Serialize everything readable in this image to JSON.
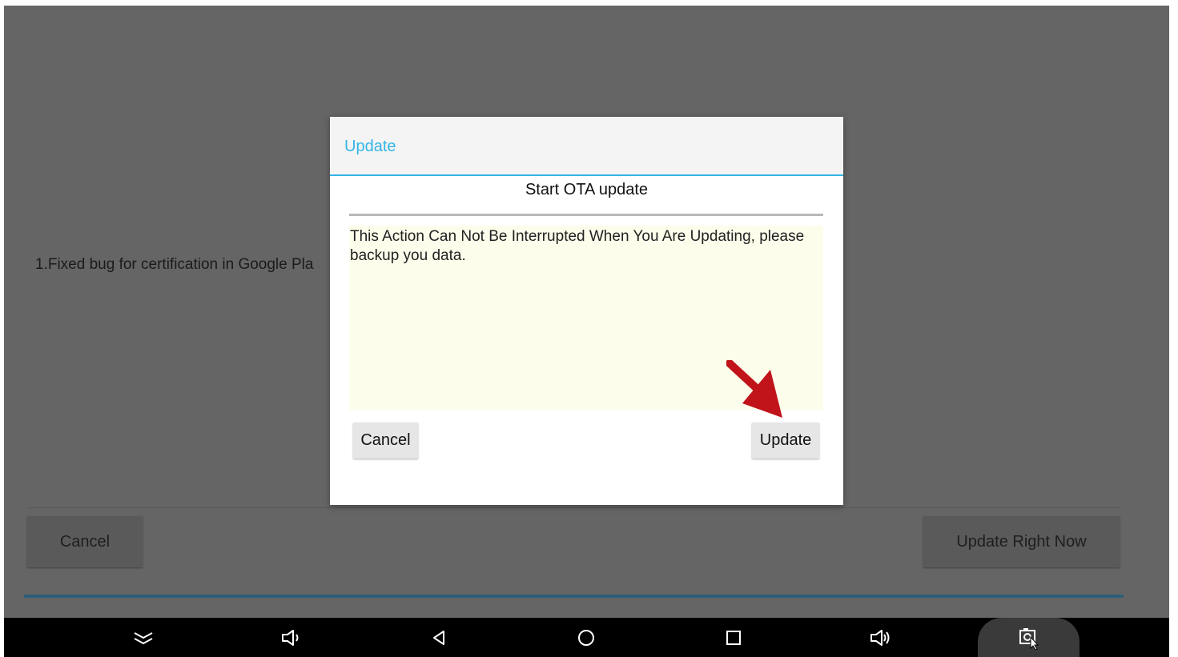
{
  "background": {
    "release_note": "1.Fixed bug for certification in Google Pla",
    "cancel_label": "Cancel",
    "update_now_label": "Update Right Now"
  },
  "dialog": {
    "title": "Update",
    "subtitle": "Start OTA update",
    "message": "This Action Can Not Be Interrupted When You Are Updating, please backup you data.",
    "cancel_label": "Cancel",
    "update_label": "Update"
  },
  "navbar": {
    "icons": [
      "chevron-double-down-icon",
      "volume-down-icon",
      "back-icon",
      "home-icon",
      "recents-icon",
      "volume-up-icon",
      "screenshot-icon"
    ]
  },
  "colors": {
    "accent": "#33b5e5",
    "annotation_arrow": "#c0141a",
    "dim_background": "#656565",
    "navbar": "#000000"
  }
}
